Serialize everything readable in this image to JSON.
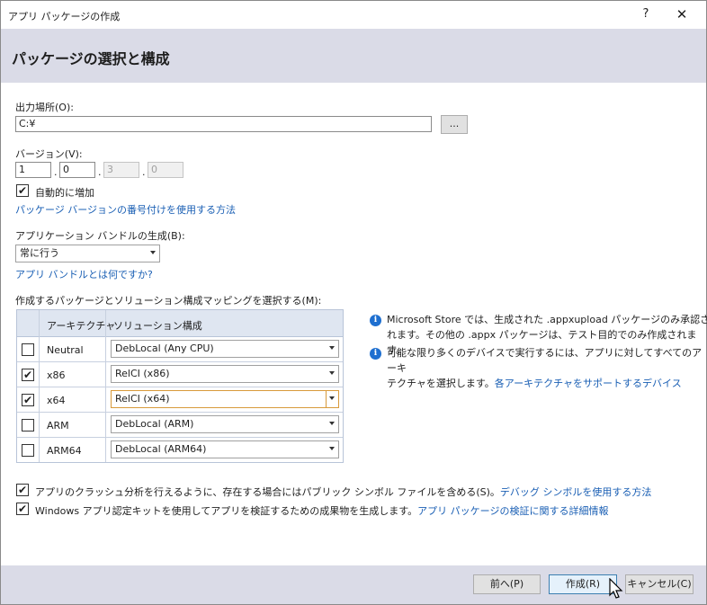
{
  "window": {
    "title": "アプリ パッケージの作成",
    "help": "?",
    "close": "✕"
  },
  "header": {
    "title": "パッケージの選択と構成"
  },
  "output": {
    "label": "出力場所(O):",
    "value": "C:¥",
    "browse_label": "..."
  },
  "version": {
    "label": "バージョン(V):",
    "major": "1",
    "minor": "0",
    "build": "3",
    "revision": "0",
    "auto_increment_label": "自動的に増加",
    "auto_increment_checked": true,
    "numbering_link": "パッケージ バージョンの番号付けを使用する方法"
  },
  "bundle": {
    "label": "アプリケーション バンドルの生成(B):",
    "selected": "常に行う",
    "link": "アプリ バンドルとは何ですか?"
  },
  "mapping": {
    "label": "作成するパッケージとソリューション構成マッピングを選択する(M):",
    "col_arch": "アーキテクチャ",
    "col_config": "ソリューション構成",
    "rows": [
      {
        "arch": "Neutral",
        "checked": false,
        "config": "DebLocal (Any CPU)"
      },
      {
        "arch": "x86",
        "checked": true,
        "config": "RelCI (x86)"
      },
      {
        "arch": "x64",
        "checked": true,
        "config": "RelCI (x64)"
      },
      {
        "arch": "ARM",
        "checked": false,
        "config": "DebLocal (ARM)"
      },
      {
        "arch": "ARM64",
        "checked": false,
        "config": "DebLocal (ARM64)"
      }
    ]
  },
  "info": {
    "line1a": "Microsoft Store では、生成された .appxupload パッケージのみ承認さ",
    "line1b": "れます。その他の .appx パッケージは、テスト目的でのみ作成されます。",
    "line2a": "可能な限り多くのデバイスで実行するには、アプリに対してすべてのアーキ",
    "line2b": "テクチャを選択します。",
    "line2_link": "各アーキテクチャをサポートするデバイス"
  },
  "options": {
    "symbols_label": "アプリのクラッシュ分析を行えるように、存在する場合にはパブリック シンボル ファイルを含める(S)。",
    "symbols_link": "デバッグ シンボルを使用する方法",
    "symbols_checked": true,
    "wack_label": "Windows アプリ認定キットを使用してアプリを検証するための成果物を生成します。",
    "wack_link": "アプリ パッケージの検証に関する詳細情報",
    "wack_checked": true
  },
  "footer": {
    "back": "前へ(P)",
    "create": "作成(R)",
    "cancel": "キャンセル(C)"
  },
  "check_glyph": "✔"
}
